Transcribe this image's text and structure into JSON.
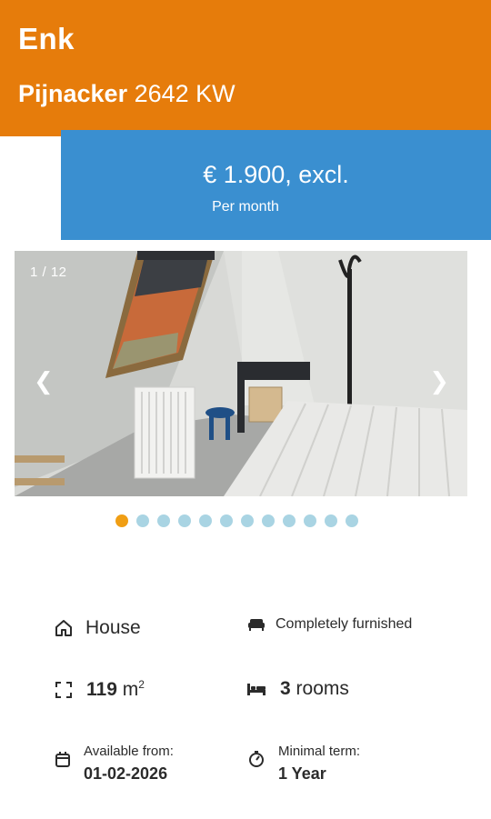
{
  "header": {
    "street": "Enk",
    "city": "Pijnacker",
    "postcode": "2642 KW",
    "background": "#e67c0b"
  },
  "price": {
    "amount": "€ 1.900, excl.",
    "period": "Per month",
    "background": "#3a8fd0"
  },
  "gallery": {
    "counter": "1 / 12",
    "prev_icon": "❮",
    "next_icon": "❯",
    "total_images": 12,
    "active_index": 1
  },
  "dots_colors": {
    "active": "#f09e14",
    "inactive": "#a9d4e3"
  },
  "features": {
    "type": {
      "icon": "house-icon",
      "label": "House"
    },
    "furnishing": {
      "icon": "sofa-icon",
      "label": "Completely furnished"
    },
    "area": {
      "icon": "area-icon",
      "value": "119",
      "unit": "m",
      "sup": "2"
    },
    "rooms": {
      "icon": "bed-icon",
      "value": "3",
      "unit": "rooms"
    },
    "available": {
      "icon": "calendar-icon",
      "caption": "Available from:",
      "value": "01-02-2026"
    },
    "term": {
      "icon": "timer-icon",
      "caption": "Minimal term:",
      "value": "1 Year"
    }
  }
}
